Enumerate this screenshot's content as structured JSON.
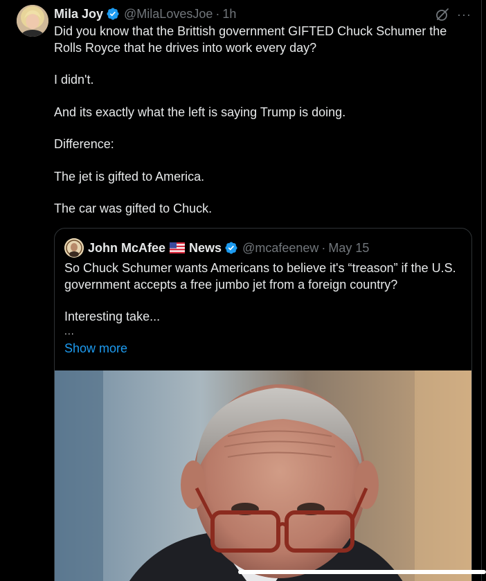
{
  "tweet": {
    "author_name": "Mila Joy",
    "author_handle": "@MilaLovesJoe",
    "separator": "·",
    "time": "1h",
    "more_label": "···",
    "paragraphs": [
      "Did you know that the Brittish government GIFTED Chuck Schumer the Rolls Royce that he drives into work every day?",
      "I didn't.",
      "And its exactly what the left is saying Trump is doing.",
      "Difference:",
      "The jet is gifted to America.",
      "The car was gifted to Chuck."
    ]
  },
  "quoted_tweet": {
    "author_name": "John McAfee",
    "author_name_suffix": "News",
    "author_handle": "@mcafeenew",
    "separator": "·",
    "time": "May 15",
    "paragraphs": [
      "So Chuck Schumer wants Americans to believe it's “treason” if the U.S. government accepts a free jumbo jet from a foreign country?",
      "Interesting take..."
    ],
    "ellipsis": "...",
    "show_more_label": "Show more"
  },
  "icons": {
    "verified": "verified-badge-icon",
    "grok": "grok-icon",
    "more": "more-options-icon",
    "flag": "us-flag-icon"
  },
  "colors": {
    "background": "#000000",
    "text": "#e7e9ea",
    "muted": "#71767b",
    "accent": "#1d9bf0",
    "border": "#2f3336"
  }
}
